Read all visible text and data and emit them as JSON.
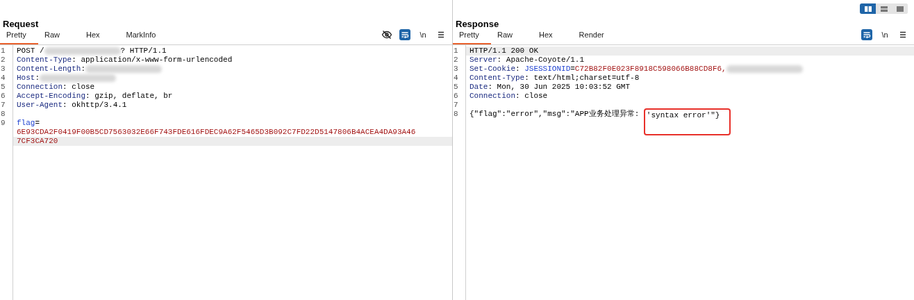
{
  "layout_toggle": [
    {
      "selected": true
    },
    {
      "selected": false
    },
    {
      "selected": false
    }
  ],
  "request": {
    "title": "Request",
    "tabs": [
      {
        "label": "Pretty",
        "selected": true
      },
      {
        "label": "Raw",
        "selected": false
      },
      {
        "label": "Hex",
        "selected": false
      },
      {
        "label": "MarkInfo",
        "selected": false
      }
    ],
    "toolbar": [
      {
        "kind": "hide"
      },
      {
        "kind": "wrap",
        "on": true
      },
      {
        "kind": "newline",
        "label": "\\n"
      },
      {
        "kind": "menu"
      }
    ],
    "lines": [
      {
        "number": "1",
        "current": false,
        "tokens": [
          {
            "kind": "plain",
            "text": "POST /"
          },
          {
            "kind": "redacted"
          },
          {
            "kind": "plain",
            "text": "? HTTP/1.1"
          }
        ]
      },
      {
        "number": "2",
        "current": false,
        "tokens": [
          {
            "kind": "header",
            "text": "Content-Type"
          },
          {
            "kind": "plain",
            "text": ": application/x-www-form-urlencoded"
          }
        ]
      },
      {
        "number": "3",
        "current": false,
        "tokens": [
          {
            "kind": "header",
            "text": "Content-Length"
          },
          {
            "kind": "plain",
            "text": ":"
          },
          {
            "kind": "redacted"
          }
        ]
      },
      {
        "number": "4",
        "current": false,
        "tokens": [
          {
            "kind": "header",
            "text": "Host"
          },
          {
            "kind": "plain",
            "text": ":"
          },
          {
            "kind": "redacted"
          }
        ]
      },
      {
        "number": "5",
        "current": false,
        "tokens": [
          {
            "kind": "header",
            "text": "Connection"
          },
          {
            "kind": "plain",
            "text": ": close"
          }
        ]
      },
      {
        "number": "6",
        "current": false,
        "tokens": [
          {
            "kind": "header",
            "text": "Accept-Encoding"
          },
          {
            "kind": "plain",
            "text": ": gzip, deflate, br"
          }
        ]
      },
      {
        "number": "7",
        "current": false,
        "tokens": [
          {
            "kind": "header",
            "text": "User-Agent"
          },
          {
            "kind": "plain",
            "text": ": okhttp/3.4.1"
          }
        ]
      },
      {
        "number": "8",
        "current": false
      },
      {
        "number": "9",
        "current": false,
        "tokens": [
          {
            "kind": "param",
            "text": "flag"
          },
          {
            "kind": "plain",
            "text": "="
          }
        ]
      },
      {
        "current": false,
        "tokens": [
          {
            "kind": "value",
            "text": "6E93CDA2F0419F00B5CD7563032E66F743FDE616FDEC9A62F5465D3B092C7FD22D5147806B4ACEA4DA93A46"
          }
        ]
      },
      {
        "current": true,
        "tokens": [
          {
            "kind": "value",
            "text": "7CF3CA720"
          }
        ]
      }
    ]
  },
  "response": {
    "title": "Response",
    "tabs": [
      {
        "label": "Pretty",
        "selected": true
      },
      {
        "label": "Raw",
        "selected": false
      },
      {
        "label": "Hex",
        "selected": false
      },
      {
        "label": "Render",
        "selected": false
      }
    ],
    "toolbar": [
      {
        "kind": "wrap",
        "on": true
      },
      {
        "kind": "newline",
        "label": "\\n"
      },
      {
        "kind": "menu"
      }
    ],
    "lines": [
      {
        "number": "1",
        "current": true,
        "tokens": [
          {
            "kind": "plain",
            "text": "HTTP/1.1 200 OK"
          }
        ]
      },
      {
        "number": "2",
        "current": false,
        "tokens": [
          {
            "kind": "header",
            "text": "Server"
          },
          {
            "kind": "plain",
            "text": ": Apache-Coyote/1.1"
          }
        ]
      },
      {
        "number": "3",
        "current": false,
        "tokens": [
          {
            "kind": "header",
            "text": "Set-Cookie"
          },
          {
            "kind": "plain",
            "text": ": "
          },
          {
            "kind": "param",
            "text": "JSESSIONID"
          },
          {
            "kind": "plain",
            "text": "="
          },
          {
            "kind": "value",
            "text": "C72B82F0E023F8918C598066B88CD8F6,"
          },
          {
            "kind": "redacted"
          }
        ]
      },
      {
        "number": "4",
        "current": false,
        "tokens": [
          {
            "kind": "header",
            "text": "Content-Type"
          },
          {
            "kind": "plain",
            "text": ": text/html;charset=utf-8"
          }
        ]
      },
      {
        "number": "5",
        "current": false,
        "tokens": [
          {
            "kind": "header",
            "text": "Date"
          },
          {
            "kind": "plain",
            "text": ": Mon, 30 Jun 2025 10:03:52 GMT"
          }
        ]
      },
      {
        "number": "6",
        "current": false,
        "tokens": [
          {
            "kind": "header",
            "text": "Connection"
          },
          {
            "kind": "plain",
            "text": ": close"
          }
        ]
      },
      {
        "number": "7",
        "current": false
      },
      {
        "number": "8",
        "current": false,
        "tokens": [
          {
            "kind": "plain",
            "text": "{\"flag\":\"error\",\"msg\":\"APP业务处理异常: "
          },
          {
            "kind": "boxed",
            "text": "'syntax error'\"}"
          }
        ]
      }
    ]
  }
}
